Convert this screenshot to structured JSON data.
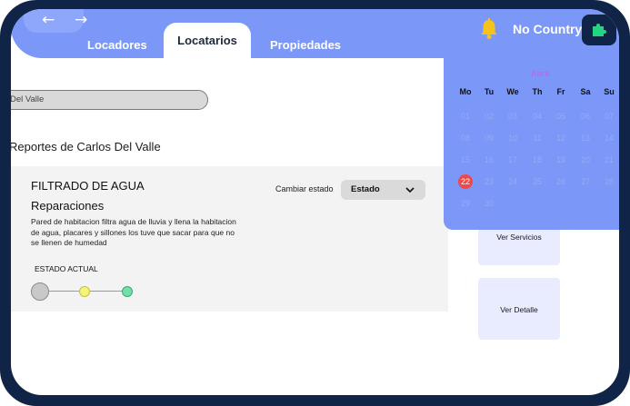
{
  "nav": {
    "back_icon": "arrow-left-icon",
    "forward_icon": "arrow-right-icon",
    "back_glyph": "←",
    "forward_glyph": "→"
  },
  "tabs": [
    {
      "label": "Locadores"
    },
    {
      "label": "Locatarios",
      "active": true
    },
    {
      "label": "Propiedades"
    }
  ],
  "header": {
    "country": "No Country",
    "bell_icon": "bell-icon",
    "extension_icon": "puzzle-icon",
    "accent": "#7b98f8"
  },
  "search": {
    "value": "Del Valle"
  },
  "reports": {
    "title": "Reportes de Carlos Del Valle"
  },
  "report_card": {
    "title": "FILTRADO DE AGUA",
    "category": "Reparaciones",
    "description": "Pared de habitacion filtra agua de lluvia y llena la habitacion de agua, placares y sillones los tuve que sacar para que no se llenen de humedad",
    "status_label": "ESTADO ACTUAL",
    "change_status_label": "Cambiar estado",
    "status_select": "Estado",
    "status_steps": [
      "#c8c8c8",
      "#f3f27c",
      "#72e0a8"
    ]
  },
  "actions": {
    "services": "Ver Servicios",
    "detail": "Ver Detalle"
  },
  "calendar": {
    "month": "Abril",
    "weekdays": [
      "Mo",
      "Tu",
      "We",
      "Th",
      "Fr",
      "Sa",
      "Su"
    ],
    "days": [
      "01",
      "02",
      "03",
      "04",
      "05",
      "06",
      "07",
      "08",
      "09",
      "10",
      "11",
      "12",
      "13",
      "14",
      "15",
      "16",
      "17",
      "18",
      "19",
      "20",
      "21",
      "22",
      "23",
      "24",
      "25",
      "26",
      "27",
      "28",
      "29",
      "30"
    ],
    "today": "22",
    "today_color": "#f04848"
  }
}
